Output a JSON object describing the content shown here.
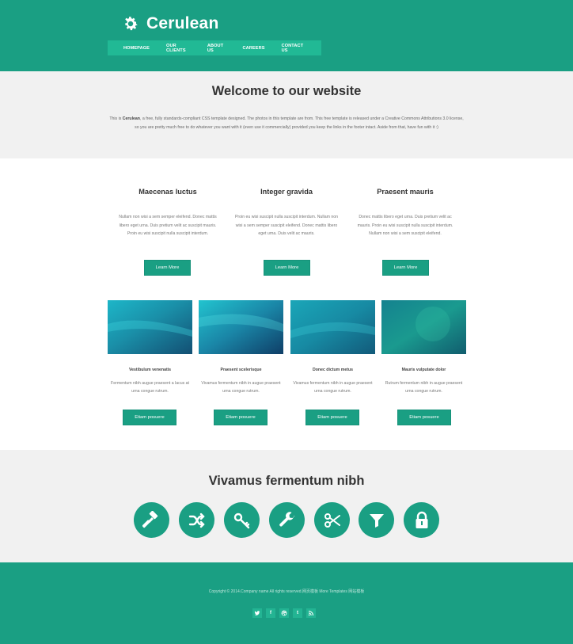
{
  "header": {
    "logo_text": "Cerulean",
    "nav": [
      "HOMEPAGE",
      "OUR CLIENTS",
      "ABOUT US",
      "CAREERS",
      "CONTACT US"
    ]
  },
  "welcome": {
    "title": "Welcome to our website",
    "intro_prefix": "This is ",
    "intro_bold": "Cerulean",
    "intro_rest": ", a free, fully standards-compliant CSS template designed. The photos in this template are from. This free template is released under a Creative Commons Attributions 3.0 license, so you are pretty much free to do whatever you want with it (even use it commercially) provided you keep the links in the footer intact. Aside from that, have fun with it :)"
  },
  "columns": [
    {
      "title": "Maecenas luctus",
      "text": "Nullam non wisi a sem semper eleifend. Donec mattis libero eget urna. Duis pretium velit ac suscipit mauris. Proin eu wisi suscipit nulla suscipit interdum.",
      "button": "Learn More"
    },
    {
      "title": "Integer gravida",
      "text": "Proin eu wisi suscipit nulla suscipit interdum. Nullam non wisi a sem semper suscipit eleifend. Donec mattis libero eget urna. Duis velit ac mauris.",
      "button": "Learn More"
    },
    {
      "title": "Praesent mauris",
      "text": "Donec mattis libero eget urna. Duis pretium velit ac mauris. Proin eu wisi suscipit nulla suscipit interdum. Nullam non wisi a sem suscipit eleifend.",
      "button": "Learn More"
    }
  ],
  "cards": [
    {
      "title": "Vestibulum venenatis",
      "text": "Fermentum nibh augue praesent a lacus at urna congue rutrum.",
      "button": "Etiam posuere"
    },
    {
      "title": "Praesent scelerisque",
      "text": "Vivamus fermentum nibh in augue praesent urna congue rutrum.",
      "button": "Etiam posuere"
    },
    {
      "title": "Donec dictum metus",
      "text": "Vivamus fermentum nibh in augue praesent urna congue rutrum.",
      "button": "Etiam posuere"
    },
    {
      "title": "Mauris vulputate dolor",
      "text": "Rutrum fermentum nibh in augue praesent urna congue rutrum.",
      "button": "Etiam posuere"
    }
  ],
  "vivamus": {
    "title": "Vivamus fermentum nibh",
    "icons": [
      "gavel-icon",
      "shuffle-icon",
      "key-icon",
      "wrench-icon",
      "scissors-icon",
      "filter-icon",
      "lock-icon"
    ]
  },
  "footer": {
    "copyright": "Copyright © 2014.Company name All rights reserved.网页模板   More Templates 网站模板",
    "social": [
      "twitter-icon",
      "facebook-icon",
      "dribbble-icon",
      "tumblr-icon",
      "rss-icon"
    ],
    "social_glyphs": {
      "facebook": "f",
      "tumblr": "t"
    }
  },
  "colors": {
    "brand": "#1a9f83",
    "nav_bg": "#21b995",
    "section_bg": "#f1f1f1"
  }
}
